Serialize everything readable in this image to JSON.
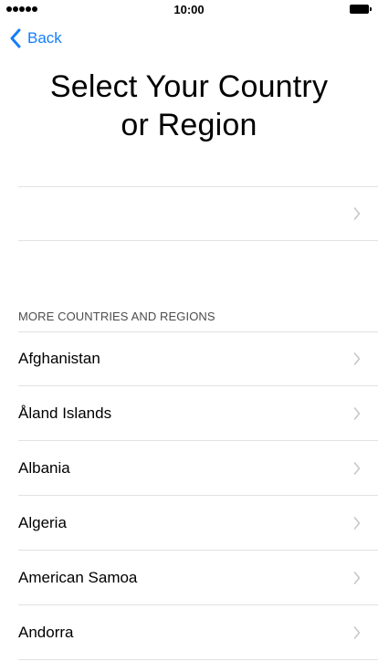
{
  "status_bar": {
    "time": "10:00",
    "signal_bars": 5
  },
  "nav": {
    "back_label": "Back",
    "back_icon": "chevron-left-icon"
  },
  "title": {
    "line1": "Select Your Country",
    "line2": "or Region"
  },
  "suggested": {
    "label": ""
  },
  "section_header": "MORE COUNTRIES AND REGIONS",
  "countries": [
    "Afghanistan",
    "Åland Islands",
    "Albania",
    "Algeria",
    "American Samoa",
    "Andorra"
  ],
  "colors": {
    "accent": "#157efb",
    "separator": "#e2e2e6",
    "chevron": "#c7c7cc",
    "section_text": "#4d4d4d"
  }
}
